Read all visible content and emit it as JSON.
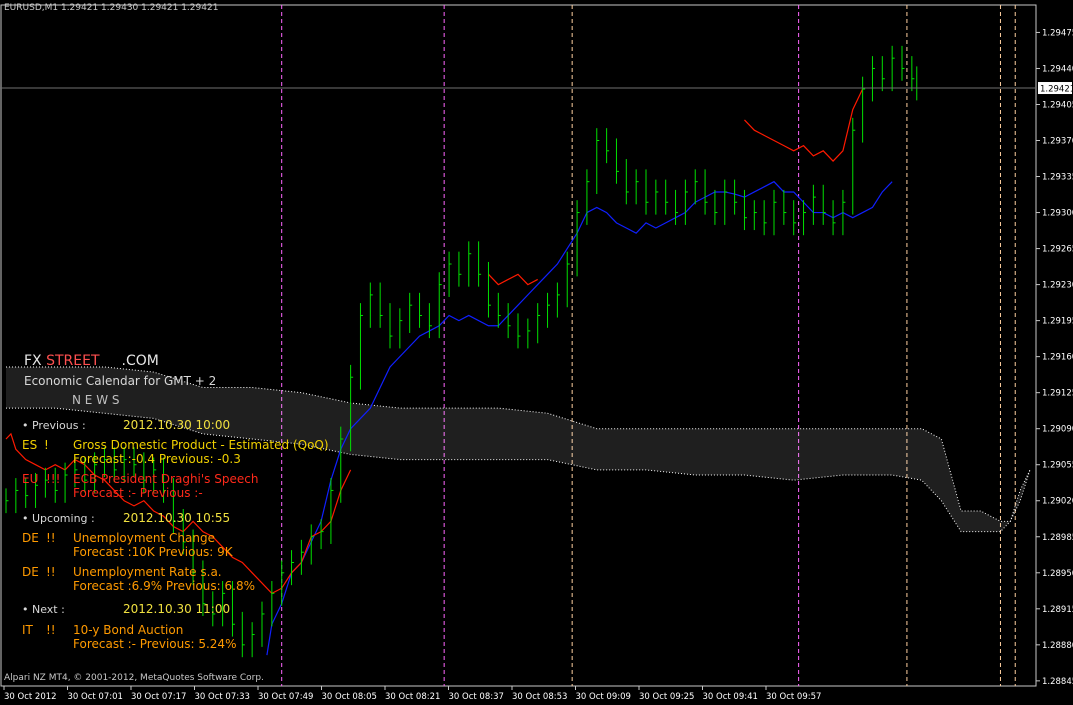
{
  "chart_title": "EURUSD,M1  1.29421 1.29430 1.29421 1.29421",
  "copyright": "Alpari NZ MT4, © 2001-2012, MetaQuotes Software Corp.",
  "current_price": "1.29421",
  "colors": {
    "background": "#000000",
    "bar": "#00e000",
    "blue_line": "#1020ff",
    "red_line": "#ff1a00",
    "session_line": "#ff66ff",
    "news_line": "#ffd0a0",
    "axis_text": "#ffffff"
  },
  "overlay": {
    "brand_left": "FX ",
    "brand_red": "STREET",
    "brand_right": ".COM",
    "subtitle": "Economic Calendar for GMT + 2",
    "news_header": "N E W S",
    "previous": {
      "label": "• Previous :",
      "time": "2012.10.30 10:00",
      "events": [
        {
          "country": "ES",
          "impact": "!",
          "title": "Gross Domestic Product - Estimated (QoQ)",
          "detail": "Forecast :-0.4 Previous: -0.3"
        },
        {
          "country": "EU",
          "impact": "!!!",
          "title": "ECB President Draghi's Speech",
          "detail": "Forecast :- Previous :-"
        }
      ]
    },
    "upcoming": {
      "label": "• Upcoming :",
      "time": "2012.10.30 10:55",
      "events": [
        {
          "country": "DE",
          "impact": "!!",
          "title": "Unemployment Change",
          "detail": "Forecast :10K Previous: 9K"
        },
        {
          "country": "DE",
          "impact": "!!",
          "title": "Unemployment Rate s.a.",
          "detail": "Forecast :6.9% Previous: 6.8%"
        }
      ]
    },
    "next": {
      "label": "• Next :",
      "time": "2012.10.30 11:00",
      "events": [
        {
          "country": "IT",
          "impact": "!!",
          "title": "10-y Bond Auction",
          "detail": "Forecast :- Previous: 5.24%"
        }
      ]
    }
  },
  "chart_data": {
    "type": "bar",
    "title": "EURUSD,M1",
    "symbol": "EURUSD",
    "timeframe": "M1",
    "ylim": [
      1.2884,
      1.2949
    ],
    "y_ticks": [
      "1.29475",
      "1.29440",
      "1.29405",
      "1.29370",
      "1.29335",
      "1.29300",
      "1.29265",
      "1.29230",
      "1.29195",
      "1.29160",
      "1.29125",
      "1.29090",
      "1.29055",
      "1.29020",
      "1.28985",
      "1.28950",
      "1.28915",
      "1.28880",
      "1.28845"
    ],
    "x_ticks": [
      "30 Oct 2012",
      "30 Oct 07:01",
      "30 Oct 07:17",
      "30 Oct 07:33",
      "30 Oct 07:49",
      "30 Oct 08:05",
      "30 Oct 08:21",
      "30 Oct 08:37",
      "30 Oct 08:53",
      "30 Oct 09:09",
      "30 Oct 09:25",
      "30 Oct 09:41",
      "30 Oct 09:57"
    ],
    "x_range_minutes": [
      0,
      208
    ],
    "close_series": [
      [
        0,
        1.2902
      ],
      [
        2,
        1.2903
      ],
      [
        4,
        1.29025
      ],
      [
        6,
        1.29035
      ],
      [
        8,
        1.2904
      ],
      [
        10,
        1.2903
      ],
      [
        12,
        1.29045
      ],
      [
        14,
        1.2905
      ],
      [
        16,
        1.2904
      ],
      [
        18,
        1.29055
      ],
      [
        20,
        1.2906
      ],
      [
        22,
        1.2905
      ],
      [
        24,
        1.2906
      ],
      [
        26,
        1.29055
      ],
      [
        28,
        1.2904
      ],
      [
        30,
        1.2905
      ],
      [
        32,
        1.2903
      ],
      [
        34,
        1.29
      ],
      [
        36,
        1.2898
      ],
      [
        38,
        1.2895
      ],
      [
        40,
        1.2892
      ],
      [
        42,
        1.2891
      ],
      [
        44,
        1.2893
      ],
      [
        46,
        1.289
      ],
      [
        48,
        1.2888
      ],
      [
        50,
        1.2889
      ],
      [
        52,
        1.2891
      ],
      [
        54,
        1.2893
      ],
      [
        56,
        1.2895
      ],
      [
        58,
        1.2896
      ],
      [
        60,
        1.2897
      ],
      [
        62,
        1.28985
      ],
      [
        64,
        1.2899
      ],
      [
        66,
        1.2903
      ],
      [
        68,
        1.2908
      ],
      [
        70,
        1.2914
      ],
      [
        72,
        1.292
      ],
      [
        74,
        1.2922
      ],
      [
        76,
        1.292
      ],
      [
        78,
        1.2918
      ],
      [
        80,
        1.29195
      ],
      [
        82,
        1.2921
      ],
      [
        84,
        1.292
      ],
      [
        86,
        1.2919
      ],
      [
        88,
        1.2923
      ],
      [
        90,
        1.2925
      ],
      [
        92,
        1.2924
      ],
      [
        94,
        1.2926
      ],
      [
        96,
        1.2924
      ],
      [
        98,
        1.2921
      ],
      [
        100,
        1.292
      ],
      [
        102,
        1.2919
      ],
      [
        104,
        1.2918
      ],
      [
        106,
        1.29185
      ],
      [
        108,
        1.292
      ],
      [
        110,
        1.2921
      ],
      [
        112,
        1.2922
      ],
      [
        114,
        1.2925
      ],
      [
        116,
        1.293
      ],
      [
        118,
        1.2933
      ],
      [
        120,
        1.2937
      ],
      [
        122,
        1.2936
      ],
      [
        124,
        1.2934
      ],
      [
        126,
        1.2932
      ],
      [
        128,
        1.2933
      ],
      [
        130,
        1.2931
      ],
      [
        132,
        1.2932
      ],
      [
        134,
        1.2931
      ],
      [
        136,
        1.293
      ],
      [
        138,
        1.2932
      ],
      [
        140,
        1.2933
      ],
      [
        142,
        1.2931
      ],
      [
        144,
        1.293
      ],
      [
        146,
        1.2932
      ],
      [
        148,
        1.2931
      ],
      [
        150,
        1.29295
      ],
      [
        152,
        1.293
      ],
      [
        154,
        1.2929
      ],
      [
        156,
        1.2931
      ],
      [
        158,
        1.293
      ],
      [
        160,
        1.2929
      ],
      [
        162,
        1.293
      ],
      [
        164,
        1.29315
      ],
      [
        166,
        1.293
      ],
      [
        168,
        1.2929
      ],
      [
        170,
        1.2931
      ],
      [
        172,
        1.2938
      ],
      [
        174,
        1.2942
      ],
      [
        176,
        1.2944
      ],
      [
        178,
        1.2943
      ],
      [
        180,
        1.2945
      ],
      [
        182,
        1.2944
      ],
      [
        184,
        1.2943
      ],
      [
        185,
        1.29421
      ]
    ],
    "blue_series": [
      [
        53,
        1.2887
      ],
      [
        54,
        1.289
      ],
      [
        56,
        1.2892
      ],
      [
        58,
        1.2895
      ],
      [
        60,
        1.2896
      ],
      [
        62,
        1.2898
      ],
      [
        64,
        1.29
      ],
      [
        66,
        1.2904
      ],
      [
        68,
        1.2907
      ],
      [
        70,
        1.2909
      ],
      [
        72,
        1.291
      ],
      [
        74,
        1.2911
      ],
      [
        76,
        1.2913
      ],
      [
        78,
        1.2915
      ],
      [
        80,
        1.2916
      ],
      [
        82,
        1.2917
      ],
      [
        84,
        1.2918
      ],
      [
        86,
        1.29185
      ],
      [
        88,
        1.2919
      ],
      [
        90,
        1.292
      ],
      [
        92,
        1.29195
      ],
      [
        94,
        1.292
      ],
      [
        98,
        1.2919
      ],
      [
        100,
        1.2919
      ],
      [
        102,
        1.292
      ],
      [
        104,
        1.2921
      ],
      [
        106,
        1.2922
      ],
      [
        108,
        1.2923
      ],
      [
        110,
        1.2924
      ],
      [
        112,
        1.2925
      ],
      [
        114,
        1.29265
      ],
      [
        116,
        1.2928
      ],
      [
        118,
        1.293
      ],
      [
        120,
        1.29305
      ],
      [
        122,
        1.293
      ],
      [
        124,
        1.2929
      ],
      [
        126,
        1.29285
      ],
      [
        128,
        1.2928
      ],
      [
        130,
        1.2929
      ],
      [
        132,
        1.29285
      ],
      [
        134,
        1.2929
      ],
      [
        136,
        1.29295
      ],
      [
        138,
        1.293
      ],
      [
        140,
        1.2931
      ],
      [
        142,
        1.29315
      ],
      [
        144,
        1.2932
      ],
      [
        146,
        1.2932
      ],
      [
        148,
        1.29318
      ],
      [
        150,
        1.29315
      ],
      [
        152,
        1.2932
      ],
      [
        154,
        1.29325
      ],
      [
        156,
        1.2933
      ],
      [
        158,
        1.2932
      ],
      [
        160,
        1.2932
      ],
      [
        162,
        1.2931
      ],
      [
        164,
        1.293
      ],
      [
        166,
        1.293
      ],
      [
        168,
        1.29295
      ],
      [
        170,
        1.293
      ],
      [
        172,
        1.29295
      ],
      [
        174,
        1.293
      ],
      [
        176,
        1.29305
      ],
      [
        178,
        1.2932
      ],
      [
        180,
        1.2933
      ]
    ],
    "red_series": [
      [
        0,
        1.2908
      ],
      [
        1,
        1.29085
      ],
      [
        2,
        1.2907
      ],
      [
        4,
        1.2906
      ],
      [
        6,
        1.29055
      ],
      [
        8,
        1.2905
      ],
      [
        10,
        1.29055
      ],
      [
        12,
        1.2905
      ],
      [
        14,
        1.2906
      ],
      [
        16,
        1.29055
      ],
      [
        18,
        1.29045
      ],
      [
        20,
        1.2904
      ],
      [
        22,
        1.2903
      ],
      [
        24,
        1.2902
      ],
      [
        26,
        1.29015
      ],
      [
        28,
        1.2902
      ],
      [
        30,
        1.2901
      ],
      [
        32,
        1.29005
      ],
      [
        34,
        1.28995
      ],
      [
        36,
        1.2899
      ],
      [
        38,
        1.29
      ],
      [
        40,
        1.2899
      ],
      [
        42,
        1.28985
      ],
      [
        44,
        1.28975
      ],
      [
        46,
        1.28965
      ],
      [
        48,
        1.2896
      ],
      [
        50,
        1.2895
      ],
      [
        52,
        1.2894
      ],
      [
        54,
        1.2893
      ],
      [
        56,
        1.28935
      ],
      [
        58,
        1.2895
      ],
      [
        60,
        1.2896
      ],
      [
        62,
        1.28985
      ],
      [
        64,
        1.2899
      ],
      [
        66,
        1.29
      ],
      [
        68,
        1.2903
      ],
      [
        70,
        1.2905
      ],
      [
        98,
        1.2924
      ],
      [
        100,
        1.2923
      ],
      [
        102,
        1.29235
      ],
      [
        104,
        1.2924
      ],
      [
        106,
        1.2923
      ],
      [
        108,
        1.29235
      ],
      [
        150,
        1.2939
      ],
      [
        152,
        1.2938
      ],
      [
        154,
        1.29375
      ],
      [
        156,
        1.2937
      ],
      [
        158,
        1.29365
      ],
      [
        160,
        1.2936
      ],
      [
        162,
        1.29365
      ],
      [
        164,
        1.29355
      ],
      [
        166,
        1.2936
      ],
      [
        168,
        1.2935
      ],
      [
        170,
        1.2936
      ],
      [
        172,
        1.294
      ],
      [
        174,
        1.2942
      ]
    ],
    "envelope_upper": [
      [
        0,
        1.2915
      ],
      [
        10,
        1.2915
      ],
      [
        20,
        1.2915
      ],
      [
        30,
        1.29145
      ],
      [
        40,
        1.2913
      ],
      [
        50,
        1.2913
      ],
      [
        60,
        1.29125
      ],
      [
        70,
        1.29115
      ],
      [
        80,
        1.2911
      ],
      [
        90,
        1.2911
      ],
      [
        100,
        1.2911
      ],
      [
        110,
        1.29105
      ],
      [
        120,
        1.2909
      ],
      [
        130,
        1.2909
      ],
      [
        140,
        1.2909
      ],
      [
        150,
        1.2909
      ],
      [
        160,
        1.2909
      ],
      [
        170,
        1.2909
      ],
      [
        180,
        1.2909
      ],
      [
        186,
        1.2909
      ],
      [
        190,
        1.2908
      ],
      [
        194,
        1.2901
      ],
      [
        198,
        1.2901
      ],
      [
        202,
        1.29
      ],
      [
        204,
        1.29
      ],
      [
        206,
        1.2903
      ],
      [
        208,
        1.2905
      ]
    ],
    "envelope_lower": [
      [
        0,
        1.2911
      ],
      [
        10,
        1.2911
      ],
      [
        20,
        1.29105
      ],
      [
        30,
        1.291
      ],
      [
        40,
        1.29085
      ],
      [
        50,
        1.2908
      ],
      [
        60,
        1.29075
      ],
      [
        70,
        1.29065
      ],
      [
        80,
        1.2906
      ],
      [
        90,
        1.2906
      ],
      [
        100,
        1.2906
      ],
      [
        110,
        1.2906
      ],
      [
        120,
        1.2905
      ],
      [
        130,
        1.2905
      ],
      [
        140,
        1.29045
      ],
      [
        150,
        1.29045
      ],
      [
        160,
        1.2904
      ],
      [
        170,
        1.29045
      ],
      [
        180,
        1.29045
      ],
      [
        186,
        1.2904
      ],
      [
        190,
        1.2902
      ],
      [
        194,
        1.2899
      ],
      [
        198,
        1.2899
      ],
      [
        202,
        1.2899
      ],
      [
        204,
        1.29
      ],
      [
        206,
        1.2902
      ],
      [
        208,
        1.2905
      ]
    ],
    "session_lines_minutes": [
      56,
      89,
      161
    ],
    "news_lines_minutes": [
      115,
      183,
      202,
      205
    ],
    "grid": false
  }
}
